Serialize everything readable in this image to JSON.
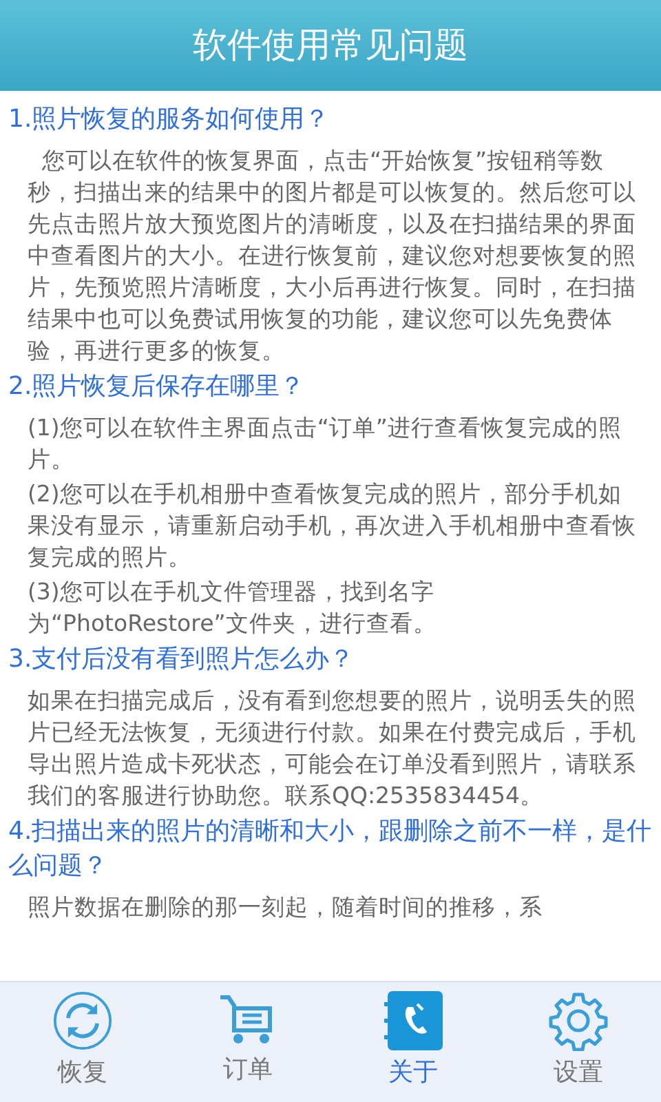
{
  "header": {
    "title": "软件使用常见问题"
  },
  "faq": [
    {
      "question": "1.照片恢复的服务如何使用？",
      "answer": [
        "  您可以在软件的恢复界面，点击“开始恢复”按钮稍等数秒，扫描出来的结果中的图片都是可以恢复的。然后您可以先点击照片放大预览图片的清晰度，以及在扫描结果的界面中查看图片的大小。在进行恢复前，建议您对想要恢复的照片，先预览照片清晰度，大小后再进行恢复。同时，在扫描结果中也可以免费试用恢复的功能，建议您可以先免费体验，再进行更多的恢复。"
      ]
    },
    {
      "question": "2.照片恢复后保存在哪里？",
      "answer": [
        "(1)您可以在软件主界面点击“订单”进行查看恢复完成的照片。",
        "(2)您可以在手机相册中查看恢复完成的照片，部分手机如果没有显示，请重新启动手机，再次进入手机相册中查看恢复完成的照片。",
        "(3)您可以在手机文件管理器，找到名字为“PhotoRestore”文件夹，进行查看。"
      ]
    },
    {
      "question": "3.支付后没有看到照片怎么办？",
      "answer": [
        "如果在扫描完成后，没有看到您想要的照片，说明丢失的照片已经无法恢复，无须进行付款。如果在付费完成后，手机导出照片造成卡死状态，可能会在订单没看到照片，请联系我们的客服进行协助您。联系QQ:2535834454。"
      ]
    },
    {
      "question": "4.扫描出来的照片的清晰和大小，跟删除之前不一样，是什么问题？",
      "answer": [
        "照片数据在删除的那一刻起，随着时间的推移，系"
      ]
    }
  ],
  "tabs": [
    {
      "label": "恢复",
      "kind": "refresh",
      "selected": false
    },
    {
      "label": "订单",
      "kind": "cart",
      "selected": false
    },
    {
      "label": "关于",
      "kind": "phone",
      "selected": true
    },
    {
      "label": "设置",
      "kind": "gear",
      "selected": false
    }
  ]
}
